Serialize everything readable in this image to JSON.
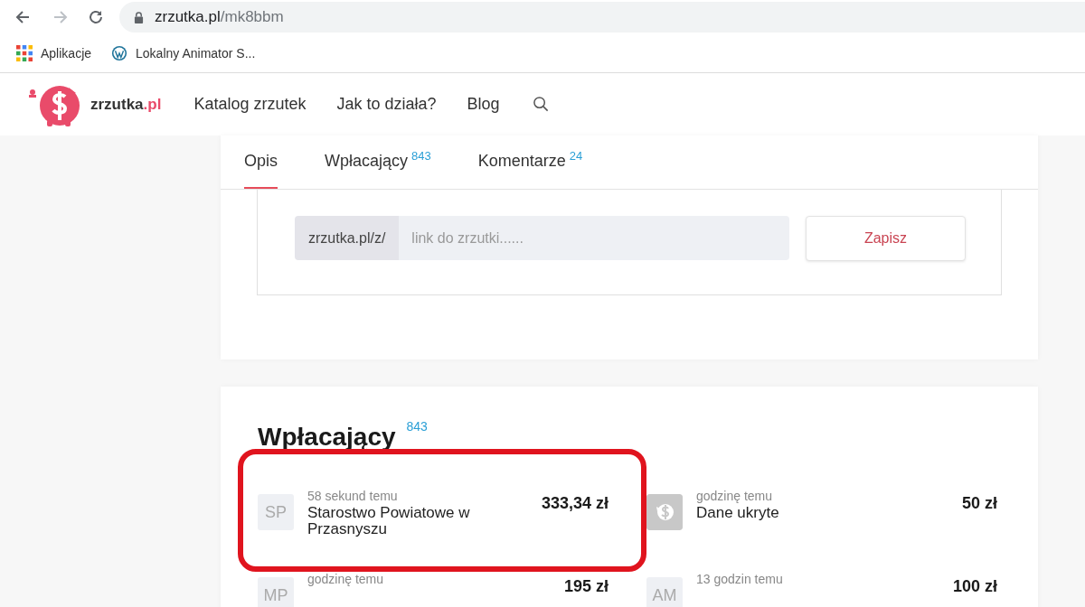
{
  "browser": {
    "url_host": "zrzutka.pl",
    "url_path": "/mk8bbm",
    "bookmarks": [
      {
        "kind": "apps",
        "label": "Aplikacje"
      },
      {
        "kind": "wordpress",
        "label": "Lokalny Animator S..."
      }
    ]
  },
  "site": {
    "logo_text": "zrzutka",
    "logo_suffix": ".pl",
    "nav": [
      "Katalog zrzutek",
      "Jak to działa?",
      "Blog"
    ]
  },
  "tabs": [
    {
      "label": "Opis",
      "selected": true
    },
    {
      "label": "Wpłacający",
      "count": "843",
      "selected": false
    },
    {
      "label": "Komentarze",
      "count": "24",
      "selected": false
    }
  ],
  "link_form": {
    "prefix": "zrzutka.pl/z/",
    "placeholder": "link do zrzutki......",
    "button": "Zapisz"
  },
  "donors_section": {
    "title": "Wpłacający",
    "count": "843",
    "donors": [
      {
        "kind": "initials",
        "initials": "SP",
        "time": "58 sekund temu",
        "name": "Starostwo Powiatowe w Przasnyszu",
        "amount": "333,34 zł",
        "highlighted": true
      },
      {
        "kind": "hidden",
        "time": "godzinę temu",
        "name": "Dane ukryte",
        "amount": "50 zł",
        "highlighted": false
      },
      {
        "kind": "initials",
        "initials": "MP",
        "time": "godzinę temu",
        "amount": "195 zł",
        "highlighted": false
      },
      {
        "kind": "initials",
        "initials": "AM",
        "time": "13 godzin temu",
        "amount": "100 zł",
        "highlighted": false
      }
    ]
  }
}
